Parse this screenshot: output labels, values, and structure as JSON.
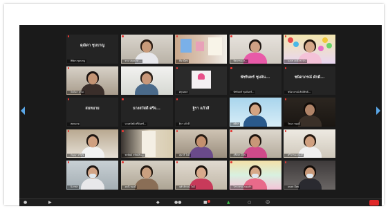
{
  "colors": {
    "window_bg": "#1a1a1a",
    "tile_bg": "#262626",
    "active_speaker": "#f5d800",
    "muted_mic": "#e53935",
    "leave_button": "#e02828",
    "nav_arrow": "#5aa7e8"
  },
  "grid": {
    "tiles": [
      {
        "name": "คุณิดา ชุมบาญ",
        "label": "ทิพิดา ชุมบาญ",
        "muted": true,
        "video": false
      },
      {
        "name": "",
        "label": "ทาง ปทุมมาศ ...",
        "muted": true,
        "video": true,
        "scene": "classroom-woman"
      },
      {
        "name": "",
        "label": "ที่ยวมีสุข",
        "muted": true,
        "video": true,
        "scene": "room-posters"
      },
      {
        "name": "",
        "label": "ทิพวรรณ ท...",
        "muted": true,
        "video": true,
        "scene": "woman-pink"
      },
      {
        "name": "",
        "label": "บงกช ฤทธิ์กระจ่าง",
        "muted": true,
        "video": true,
        "scene": "balloons-girl"
      },
      {
        "name": "",
        "label": "จันทิมา ฐานะ",
        "muted": true,
        "video": true,
        "scene": "woman-lean"
      },
      {
        "name": "",
        "label": "",
        "muted": false,
        "video": true,
        "scene": "office-bright"
      },
      {
        "name": "",
        "label": "ศกุนตลา",
        "muted": true,
        "video": true,
        "scene": "poster-card"
      },
      {
        "name": "พัชรินทร์ ชุมจัน...",
        "label": "พัชรินทร์ ชุมจันทร์...",
        "muted": true,
        "video": false
      },
      {
        "name": "ชนิดาภรณ์ ศักดิ์...",
        "label": "ชนิดาภรณ์ ศักดิ์สิทธิ์...",
        "muted": true,
        "video": false
      },
      {
        "name": "สมหมาย",
        "label": "สมหมาย",
        "muted": true,
        "video": false
      },
      {
        "name": "นางสวัสดิ์ ศรีจ...",
        "label": "นางสวัสดิ์ ศรีจันทร์...",
        "muted": true,
        "video": false
      },
      {
        "name": "ฐิรา แก้วสี",
        "label": "ฐิรา แก้วสี",
        "muted": true,
        "video": false
      },
      {
        "name": "",
        "label": "ศศิธร",
        "muted": false,
        "video": true,
        "scene": "speaker-blue",
        "active": true
      },
      {
        "name": "",
        "label": "วันนา ทองดี",
        "muted": true,
        "video": true,
        "scene": "dark-room"
      },
      {
        "name": "",
        "label": "กัญญา ทวีสุข",
        "muted": true,
        "video": true,
        "scene": "woman-white"
      },
      {
        "name": "",
        "label": "พรทิพย์ ทรัพย์สิน...",
        "muted": true,
        "video": true,
        "scene": "door-room"
      },
      {
        "name": "",
        "label": "สุมาลี ใจดี",
        "muted": true,
        "video": true,
        "scene": "cabinet-room"
      },
      {
        "name": "",
        "label": "สุรีย์พร มีสุข",
        "muted": true,
        "video": true,
        "scene": "woman-desk"
      },
      {
        "name": "",
        "label": "ศรีวรรณ ทองดี",
        "muted": true,
        "video": true,
        "scene": "kitchen"
      },
      {
        "name": "",
        "label": "นิภาพร",
        "muted": true,
        "video": true,
        "scene": "masked-woman"
      },
      {
        "name": "",
        "label": "อรุณี ทองดี",
        "muted": true,
        "video": true,
        "scene": "glasses-woman"
      },
      {
        "name": "",
        "label": "จุฬาลักษณ์ ใจดี",
        "muted": true,
        "video": true,
        "scene": "young-woman"
      },
      {
        "name": "",
        "label": "วิภาวรรณ ทองคำ",
        "muted": true,
        "video": true,
        "scene": "rainbow-woman"
      },
      {
        "name": "",
        "label": "ธนพร มีสุข",
        "muted": true,
        "video": true,
        "scene": "glasses-dark"
      }
    ]
  },
  "toolbar": {
    "items": [
      "mic",
      "video",
      "security",
      "participants",
      "chat",
      "share-screen",
      "record",
      "reactions",
      "leave"
    ]
  }
}
